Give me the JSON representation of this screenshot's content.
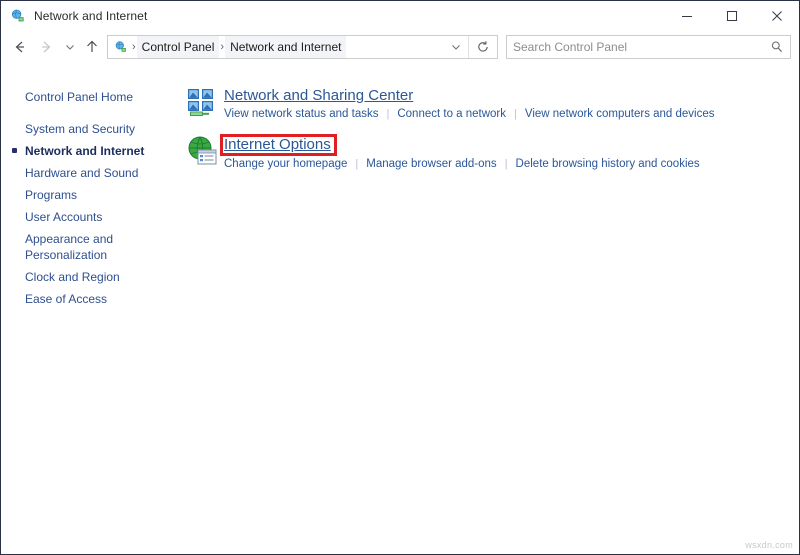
{
  "window": {
    "title": "Network and Internet",
    "title_icon": "network-globe-icon",
    "controls": {
      "minimize": "minimize-button",
      "maximize": "maximize-button",
      "close": "close-button"
    }
  },
  "navbar": {
    "back": "back-arrow-icon",
    "forward": "forward-arrow-icon",
    "recent": "chevron-down-icon",
    "up": "up-arrow-icon",
    "breadcrumb_icon": "network-globe-icon",
    "breadcrumbs": [
      "Control Panel",
      "Network and Internet"
    ],
    "separator": "›",
    "address_dropdown": "chevron-down-icon",
    "refresh": "refresh-icon"
  },
  "search": {
    "placeholder": "Search Control Panel",
    "value": "",
    "icon": "search-icon"
  },
  "sidebar": {
    "items": [
      {
        "label": "Control Panel Home",
        "current": false
      },
      {
        "label": "System and Security",
        "current": false
      },
      {
        "label": "Network and Internet",
        "current": true
      },
      {
        "label": "Hardware and Sound",
        "current": false
      },
      {
        "label": "Programs",
        "current": false
      },
      {
        "label": "User Accounts",
        "current": false
      },
      {
        "label": "Appearance and\nPersonalization",
        "current": false
      },
      {
        "label": "Clock and Region",
        "current": false
      },
      {
        "label": "Ease of Access",
        "current": false
      }
    ]
  },
  "main": {
    "categories": [
      {
        "title": "Network and Sharing Center",
        "icon": "network-sharing-center-icon",
        "highlighted": false,
        "links": [
          "View network status and tasks",
          "Connect to a network",
          "View network computers and devices"
        ]
      },
      {
        "title": "Internet Options",
        "icon": "internet-options-icon",
        "highlighted": true,
        "highlight_color": "#e02020",
        "links": [
          "Change your homepage",
          "Manage browser add-ons",
          "Delete browsing history and cookies"
        ]
      }
    ]
  },
  "watermark": "wsxdn.com",
  "colors": {
    "link": "#2b5797",
    "sidebar_link": "#2f4f8f",
    "highlight": "#e02020",
    "window_border": "#2b3245"
  }
}
